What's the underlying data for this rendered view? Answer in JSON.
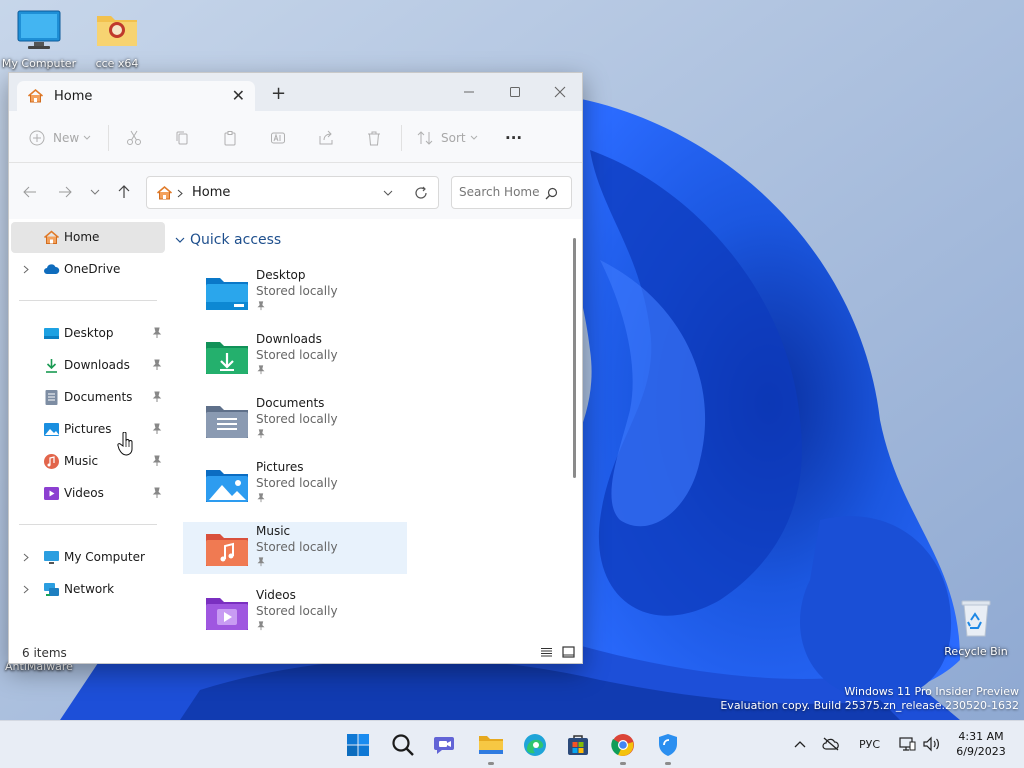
{
  "desktop": {
    "icons": [
      {
        "label": "My Computer",
        "icon": "monitor-icon"
      },
      {
        "label": "cce x64",
        "icon": "folder-icon"
      },
      {
        "label": "AntiMalware",
        "icon": "shield-icon"
      },
      {
        "label": "Recycle Bin",
        "icon": "recycle-bin-icon"
      }
    ],
    "watermark": {
      "line1": "Windows 11 Pro Insider Preview",
      "line2": "Evaluation copy. Build 25375.zn_release.230520-1632"
    }
  },
  "explorer": {
    "tab": {
      "title": "Home",
      "icon": "home-icon",
      "close": "✕"
    },
    "new_tab": "+",
    "toolbar": {
      "new_label": "New",
      "sort_label": "Sort",
      "more": "···"
    },
    "address": {
      "crumb": "Home"
    },
    "search": {
      "placeholder": "Search Home"
    },
    "nav": {
      "home": "Home",
      "onedrive": "OneDrive",
      "pinned": [
        {
          "label": "Desktop",
          "icon": "desktop-folder-icon"
        },
        {
          "label": "Downloads",
          "icon": "download-icon"
        },
        {
          "label": "Documents",
          "icon": "document-icon"
        },
        {
          "label": "Pictures",
          "icon": "picture-icon"
        },
        {
          "label": "Music",
          "icon": "music-icon"
        },
        {
          "label": "Videos",
          "icon": "video-icon"
        }
      ],
      "computer": "My Computer",
      "network": "Network"
    },
    "quick_access": {
      "header": "Quick access",
      "items": [
        {
          "name": "Desktop",
          "sub": "Stored locally"
        },
        {
          "name": "Downloads",
          "sub": "Stored locally"
        },
        {
          "name": "Documents",
          "sub": "Stored locally"
        },
        {
          "name": "Pictures",
          "sub": "Stored locally"
        },
        {
          "name": "Music",
          "sub": "Stored locally"
        },
        {
          "name": "Videos",
          "sub": "Stored locally"
        }
      ]
    },
    "status": {
      "count": "6 items"
    }
  },
  "taskbar": {
    "apps": [
      "start-icon",
      "search-icon",
      "chat-icon",
      "file-explorer-icon",
      "edge-icon",
      "store-icon",
      "chrome-icon",
      "defender-icon"
    ],
    "tray": {
      "lang": "РУС",
      "time": "4:31 AM",
      "date": "6/9/2023"
    }
  },
  "colors": {
    "accent": "#0067c0",
    "wallpaper_bg": "#9db5d8",
    "bloom_blue": "#1a4fd6"
  }
}
